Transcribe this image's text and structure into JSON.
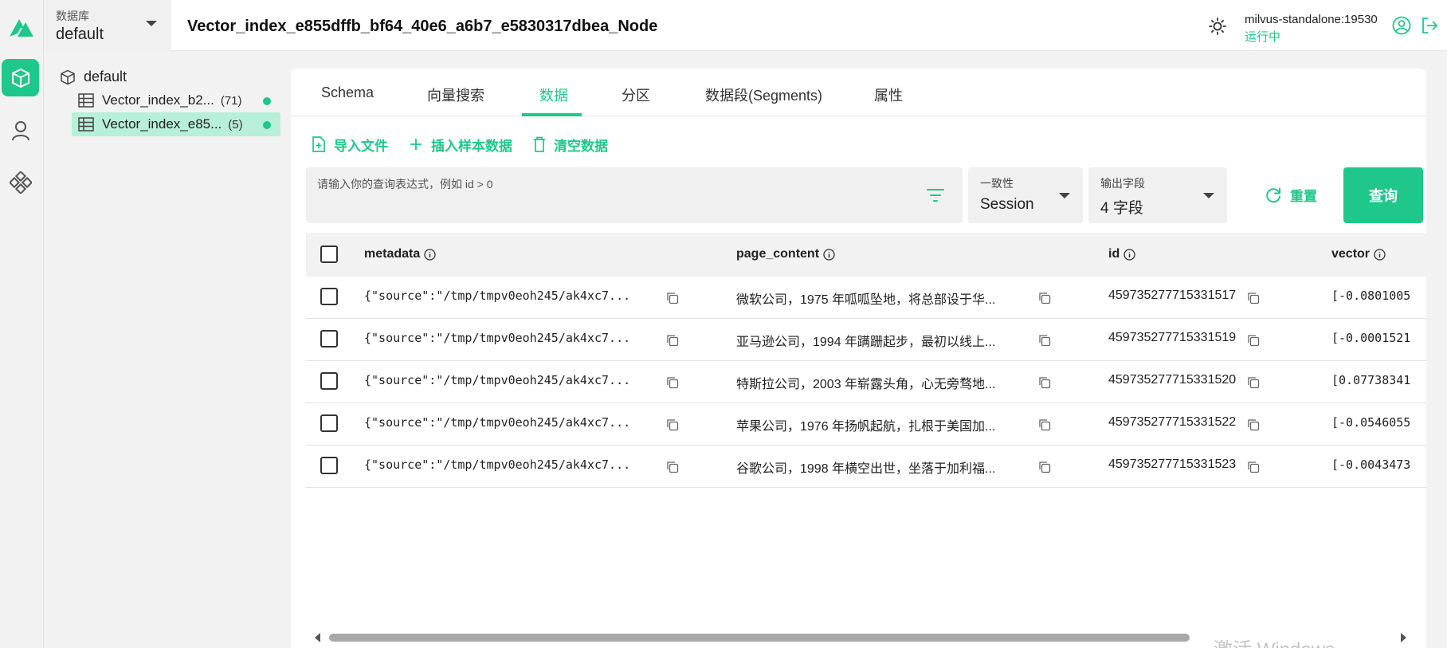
{
  "colors": {
    "accent": "#1fc88a",
    "selected_bg": "#b7efd9",
    "status_green": "#1fc88a"
  },
  "topbar": {
    "db_label": "数据库",
    "db_value": "default",
    "title": "Vector_index_e855dffb_bf64_40e6_a6b7_e5830317dbea_Node",
    "server_name": "milvus-standalone:19530",
    "server_status": "运行中"
  },
  "rail": {
    "icons": [
      "milvus-logo-icon",
      "collection-cube-icon",
      "user-icon",
      "components-icon"
    ]
  },
  "tree": {
    "root": "default",
    "items": [
      {
        "label": "Vector_index_b2...",
        "count": "(71)",
        "loaded": true
      },
      {
        "label": "Vector_index_e85...",
        "count": "(5)",
        "loaded": true
      }
    ]
  },
  "tabs": [
    {
      "label": "Schema"
    },
    {
      "label": "向量搜索"
    },
    {
      "label": "数据",
      "active": true
    },
    {
      "label": "分区"
    },
    {
      "label": "数据段(Segments)"
    },
    {
      "label": "属性"
    }
  ],
  "actions": {
    "import": "导入文件",
    "insert_sample": "插入样本数据",
    "clear": "清空数据"
  },
  "query": {
    "placeholder": "请输入你的查询表达式，例如 id > 0",
    "consistency_label": "一致性",
    "consistency_value": "Session",
    "output_label": "输出字段",
    "output_value": "4 字段",
    "reset": "重置",
    "submit": "查询"
  },
  "table": {
    "columns": [
      "metadata",
      "page_content",
      "id",
      "vector"
    ],
    "rows": [
      {
        "metadata": "{\"source\":\"/tmp/tmpv0eoh245/ak4xc7...",
        "page_content": "微软公司，1975 年呱呱坠地，将总部设于华...",
        "id": "459735277715331517",
        "vector": "[-0.0801005"
      },
      {
        "metadata": "{\"source\":\"/tmp/tmpv0eoh245/ak4xc7...",
        "page_content": "亚马逊公司，1994 年蹒跚起步，最初以线上...",
        "id": "459735277715331519",
        "vector": "[-0.0001521"
      },
      {
        "metadata": "{\"source\":\"/tmp/tmpv0eoh245/ak4xc7...",
        "page_content": "特斯拉公司，2003 年崭露头角，心无旁骛地...",
        "id": "459735277715331520",
        "vector": "[0.07738341"
      },
      {
        "metadata": "{\"source\":\"/tmp/tmpv0eoh245/ak4xc7...",
        "page_content": "苹果公司，1976 年扬帆起航，扎根于美国加...",
        "id": "459735277715331522",
        "vector": "[-0.0546055"
      },
      {
        "metadata": "{\"source\":\"/tmp/tmpv0eoh245/ak4xc7...",
        "page_content": "谷歌公司，1998 年横空出世，坐落于加利福...",
        "id": "459735277715331523",
        "vector": "[-0.0043473"
      }
    ]
  },
  "footer": {
    "windows_watermark": "激活 Windows"
  }
}
